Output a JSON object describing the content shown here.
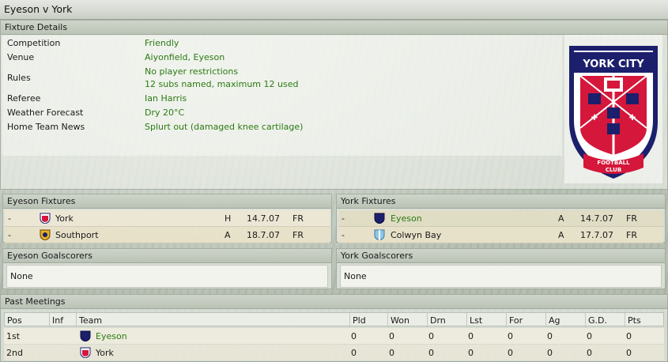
{
  "window": {
    "title": "Eyeson v York"
  },
  "fixture_details": {
    "header": "Fixture Details",
    "rows": [
      {
        "label": "Competition",
        "value": "Friendly"
      },
      {
        "label": "Venue",
        "value": "Aiyonfield, Eyeson"
      },
      {
        "label": "Rules",
        "value": "No player restrictions",
        "value2": "12 subs named, maximum 12 used"
      },
      {
        "label": "Referee",
        "value": "Ian Harris"
      },
      {
        "label": "Weather Forecast",
        "value": "Dry 20°C"
      },
      {
        "label": "Home Team News",
        "value": "Splurt out (damaged knee cartilage)"
      }
    ],
    "logo": {
      "top_text": "YORK CITY",
      "bottom_text1": "FOOTBALL",
      "bottom_text2": "CLUB"
    }
  },
  "eyeson_fixtures": {
    "header": "Eyeson Fixtures",
    "rows": [
      {
        "dash": "-",
        "team": "York",
        "venue": "H",
        "date": "14.7.07",
        "type": "FR"
      },
      {
        "dash": "-",
        "team": "Southport",
        "venue": "A",
        "date": "18.7.07",
        "type": "FR"
      }
    ]
  },
  "york_fixtures": {
    "header": "York Fixtures",
    "rows": [
      {
        "dash": "-",
        "team": "Eyeson",
        "venue": "A",
        "date": "14.7.07",
        "type": "FR"
      },
      {
        "dash": "-",
        "team": "Colwyn Bay",
        "venue": "A",
        "date": "17.7.07",
        "type": "FR"
      }
    ]
  },
  "eyeson_goalscorers": {
    "header": "Eyeson Goalscorers",
    "value": "None"
  },
  "york_goalscorers": {
    "header": "York Goalscorers",
    "value": "None"
  },
  "past_meetings": {
    "header": "Past Meetings",
    "columns": [
      "Pos",
      "Inf",
      "Team",
      "Pld",
      "Won",
      "Drn",
      "Lst",
      "For",
      "Ag",
      "G.D.",
      "Pts"
    ],
    "rows": [
      {
        "pos": "1st",
        "inf": "",
        "team": "Eyeson",
        "pld": "0",
        "won": "0",
        "drn": "0",
        "lst": "0",
        "for": "0",
        "ag": "0",
        "gd": "0",
        "pts": "0"
      },
      {
        "pos": "2nd",
        "inf": "",
        "team": "York",
        "pld": "0",
        "won": "0",
        "drn": "0",
        "lst": "0",
        "for": "0",
        "ag": "0",
        "gd": "0",
        "pts": "0"
      }
    ]
  },
  "colors": {
    "value_green": "#2a7a12",
    "york_red": "#d4173a",
    "york_navy": "#1c1f6b"
  }
}
